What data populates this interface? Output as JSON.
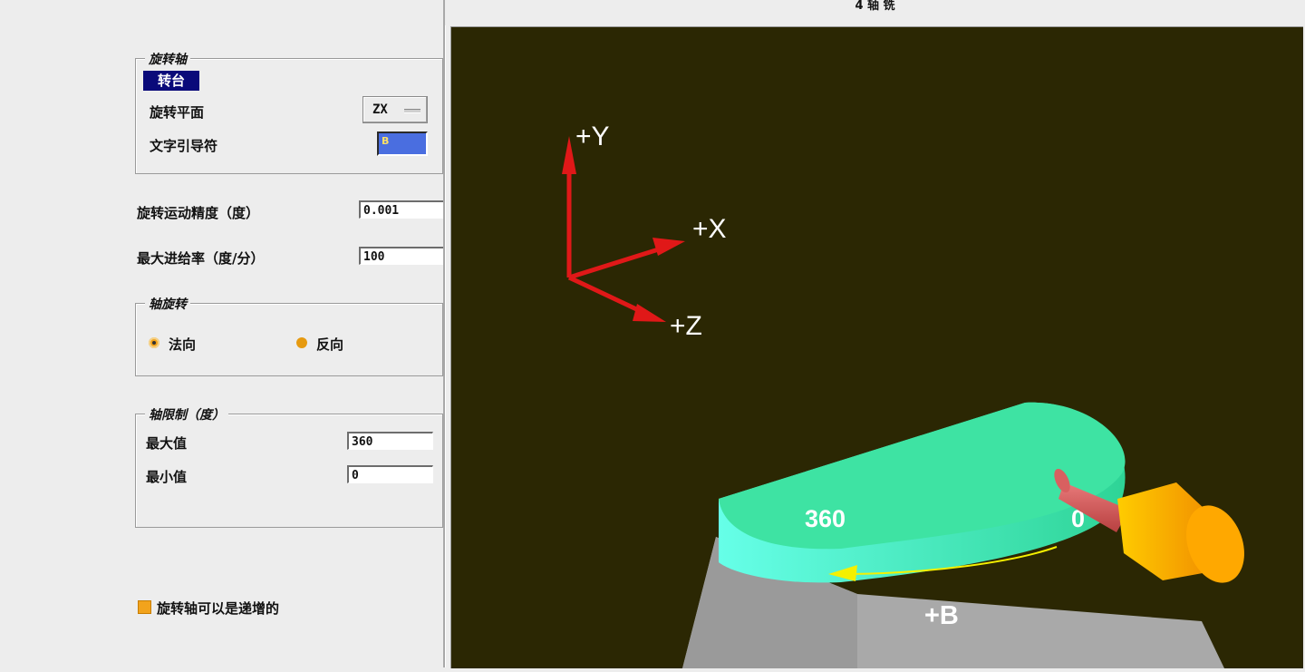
{
  "window": {
    "title": "4 轴 铣"
  },
  "rotation_axis": {
    "group_label": "旋转轴",
    "selected_item": "转台",
    "plane_label": "旋转平面",
    "plane_value": "ZX",
    "leader_label": "文字引导符",
    "leader_value": "B"
  },
  "motion": {
    "precision_label": "旋转运动精度（度）",
    "precision_value": "0.001",
    "feed_label": "最大进给率（度/分）",
    "feed_value": "100"
  },
  "axis_rotation": {
    "group_label": "轴旋转",
    "option_normal": "法向",
    "option_reverse": "反向",
    "selected": "法向"
  },
  "axis_limits": {
    "group_label": "轴限制（度）",
    "max_label": "最大值",
    "max_value": "360",
    "min_label": "最小值",
    "min_value": "0"
  },
  "incremental": {
    "label": "旋转轴可以是递增的",
    "checked": true
  },
  "viewport": {
    "axis_y": "+Y",
    "axis_x": "+X",
    "axis_z": "+Z",
    "table_label_360": "360",
    "table_label_0": "0",
    "rotation_label": "+B",
    "colors": {
      "background": "#2b2703",
      "axis": "#e01818",
      "table_top": "#3ee3a3",
      "table_edge": "#44f0c6",
      "base": "#a9a9a9",
      "motor": "#f5a300",
      "arrow": "#f5f000"
    }
  }
}
